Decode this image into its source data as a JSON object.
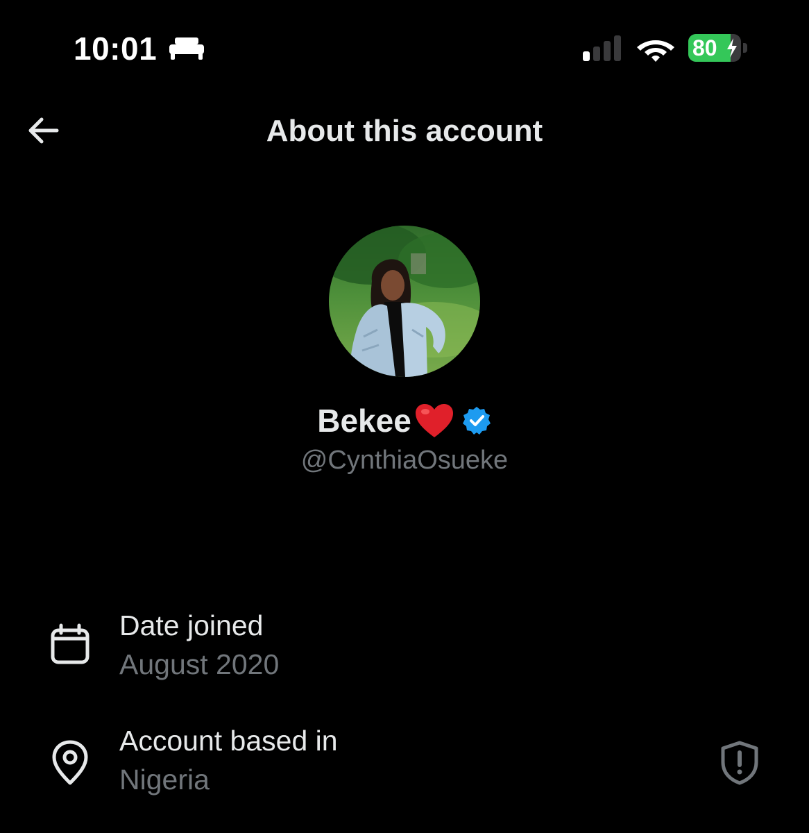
{
  "status_bar": {
    "time": "10:01",
    "battery_percent": "80",
    "battery_level": 0.8,
    "signal_bars_active": 1,
    "signal_bars_total": 4,
    "icons": [
      "bed-icon",
      "signal-icon",
      "wifi-icon",
      "battery-charging-icon"
    ],
    "battery_color": "#34c759"
  },
  "header": {
    "title": "About this account",
    "back_icon": "arrow-left-icon"
  },
  "profile": {
    "display_name": "Bekee",
    "name_emoji": "heart",
    "verified": true,
    "verified_color": "#1d9bf0",
    "handle": "@CynthiaOsueke",
    "avatar_icon": "profile-photo"
  },
  "details": [
    {
      "icon": "calendar-icon",
      "label": "Date joined",
      "value": "August 2020"
    },
    {
      "icon": "location-pin-icon",
      "label": "Account based in",
      "value": "Nigeria",
      "trailing_icon": "shield-alert-icon"
    }
  ],
  "colors": {
    "background": "#000000",
    "primary_text": "#e7e9ea",
    "secondary_text": "#71767b"
  }
}
